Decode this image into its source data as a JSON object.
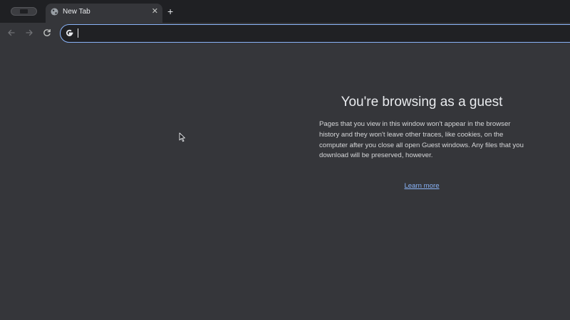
{
  "tabstrip": {
    "tab": {
      "title": "New Tab",
      "close_glyph": "✕"
    },
    "new_tab_glyph": "+"
  },
  "toolbar": {
    "omnibox": {
      "value": "",
      "icon": "google-g-icon"
    }
  },
  "content": {
    "title": "You're browsing as a guest",
    "description": "Pages that you view in this window won't appear in the browser history and they won't leave other traces, like cookies, on the computer after you close all open Guest windows. Any files that you download will be preserved, however.",
    "learn_more": "Learn more"
  },
  "colors": {
    "accent": "#8ab4f8",
    "background": "#35363a",
    "tabstrip": "#1f2023",
    "text": "#e8eaed"
  }
}
